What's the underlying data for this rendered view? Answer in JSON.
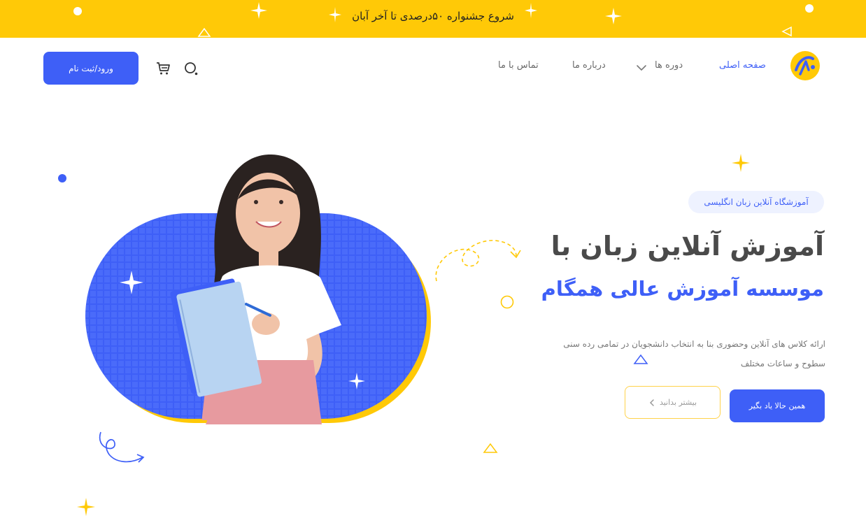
{
  "announcement": {
    "text": "شروع جشنواره ۵۰درصدی تا آخر آبان"
  },
  "header": {
    "nav": [
      {
        "label": "صفحه اصلی",
        "active": true
      },
      {
        "label": "دوره ها",
        "active": false
      },
      {
        "label": "درباره ما",
        "active": false
      },
      {
        "label": "تماس با ما",
        "active": false
      }
    ],
    "login_label": "ورود/ثبت نام"
  },
  "hero": {
    "badge": "آموزشگاه آنلاین زبان انگلیسی",
    "title_line1": "آموزش آنلاین زبان با",
    "title_line2": "موسسه آموزش عالی همگام",
    "description": "ارائه کلاس های آنلاین وحضوری بنا به انتخاب دانشجویان در تمامی رده سنی سطوح و ساعات مختلف",
    "primary_cta": "همین حالا یاد بگیر",
    "secondary_cta": "بیشتر بدانید"
  },
  "colors": {
    "brand_blue": "#3E5FF7",
    "brand_yellow": "#FFC907"
  },
  "icons": [
    "logo-icon",
    "chevron-down-icon",
    "search-icon",
    "cart-icon",
    "chevron-left-icon"
  ]
}
